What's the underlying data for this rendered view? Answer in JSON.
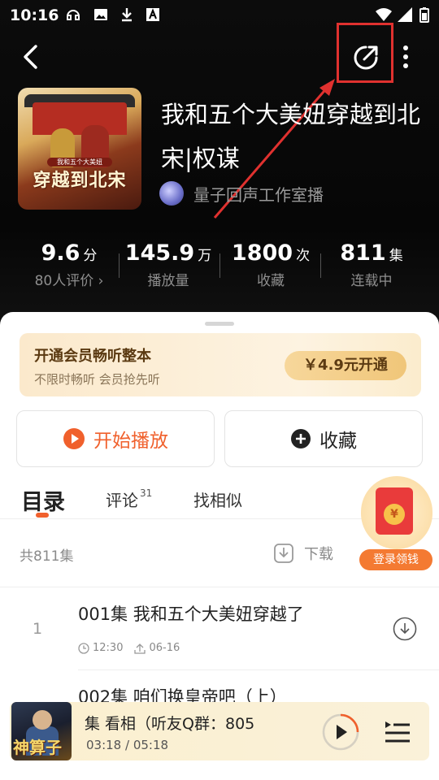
{
  "status_bar": {
    "time": "10:16"
  },
  "book": {
    "title": "我和五个大美妞穿越到北宋|权谋",
    "cover_text": "穿越到北宋",
    "cover_subtitle": "我和五个大美妞",
    "author": "量子回声工作室播"
  },
  "stats": [
    {
      "value": "9.6",
      "unit": "分",
      "label": "80人评价 ›"
    },
    {
      "value": "145.9",
      "unit": "万",
      "label": "播放量"
    },
    {
      "value": "1800",
      "unit": "次",
      "label": "收藏"
    },
    {
      "value": "811",
      "unit": "集",
      "label": "连载中"
    }
  ],
  "vip": {
    "title": "开通会员畅听整本",
    "subtitle": "不限时畅听 会员抢先听",
    "button": "￥4.9元开通"
  },
  "actions": {
    "play": "开始播放",
    "collect": "收藏"
  },
  "tabs": {
    "catalog": "目录",
    "comments": "评论",
    "comments_count": "31",
    "similar": "找相似"
  },
  "list_header": {
    "count": "共811集",
    "download": "下载"
  },
  "episodes": [
    {
      "num": "1",
      "title": "001集 我和五个大美妞穿越了",
      "duration": "12:30",
      "date": "06-16"
    },
    {
      "num": "2",
      "title": "002集 咱们换皇帝吧（上）"
    }
  ],
  "promo": {
    "label": "登录领钱",
    "coin": "¥"
  },
  "player": {
    "title": "集 看相（听友Q群：805",
    "time": "03:18 / 05:18",
    "cover_text": "神算子"
  },
  "colors": {
    "accent": "#f0602c",
    "share_highlight": "#e0312f",
    "vip_text": "#5b3a12"
  }
}
